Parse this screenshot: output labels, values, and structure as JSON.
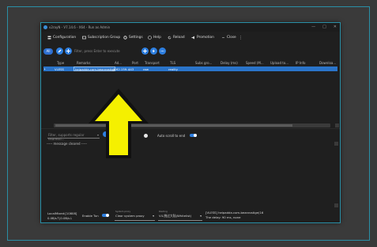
{
  "window": {
    "title": "v2rayN - V7.14.6 - X64 - Run as Admin",
    "minimize_glyph": "—",
    "maximize_glyph": "□",
    "close_glyph": "✕"
  },
  "menu": {
    "items": [
      {
        "label": "Configuration",
        "icon": "server-icon"
      },
      {
        "label": "Subscription Group",
        "icon": "subscription-icon"
      },
      {
        "label": "Settings",
        "icon": "gear-icon"
      },
      {
        "label": "Help",
        "icon": "help-icon"
      },
      {
        "label": "Reload",
        "icon": "reload-icon"
      },
      {
        "label": "Promotion",
        "icon": "megaphone-icon"
      },
      {
        "label": "Close",
        "icon": "minus-icon"
      }
    ],
    "more_glyph": "⋮"
  },
  "toolbar": {
    "group_label": "All",
    "filter_placeholder": "Filter, press Enter to execute"
  },
  "grid": {
    "columns": [
      "Type",
      "Remarks",
      "Ad...",
      "Port",
      "Transport",
      "TLS",
      "Subs gro...",
      "Delay (ms)",
      "Speed (M...",
      "Upload to...",
      "IP Info",
      "Downloa..."
    ],
    "rows": [
      {
        "type": "VLESS",
        "remarks": "heipadda.com-beanrostige",
        "address": "[162.159...",
        "port": "443",
        "transport": "raw",
        "tls": "reality"
      }
    ]
  },
  "log": {
    "filter_placeholder": "Filter, supports regular expressi...",
    "auto_scroll_label": "Auto scroll to end",
    "message": "----- message cleared -----"
  },
  "status": {
    "local_mixed": "LocalMixed:[10808]",
    "speed": "0.0B/s↑|0.0B/s↓",
    "enable_tun_label": "Enable Tun",
    "system_proxy_caption": "System proxy",
    "system_proxy_value": "Clear system proxy",
    "routing_caption": "Routing",
    "routing_value": "V4-绕过大陆(Whitelist)",
    "current_server": "[VLESS] heipadda.com-beanrostige(16",
    "delay_text": "The delay: 90 ms, none"
  },
  "colors": {
    "accent": "#2e7fe0",
    "selected_row": "#2a74c9",
    "frame": "#2a8fa6",
    "arrow_fill": "#f5f000"
  }
}
